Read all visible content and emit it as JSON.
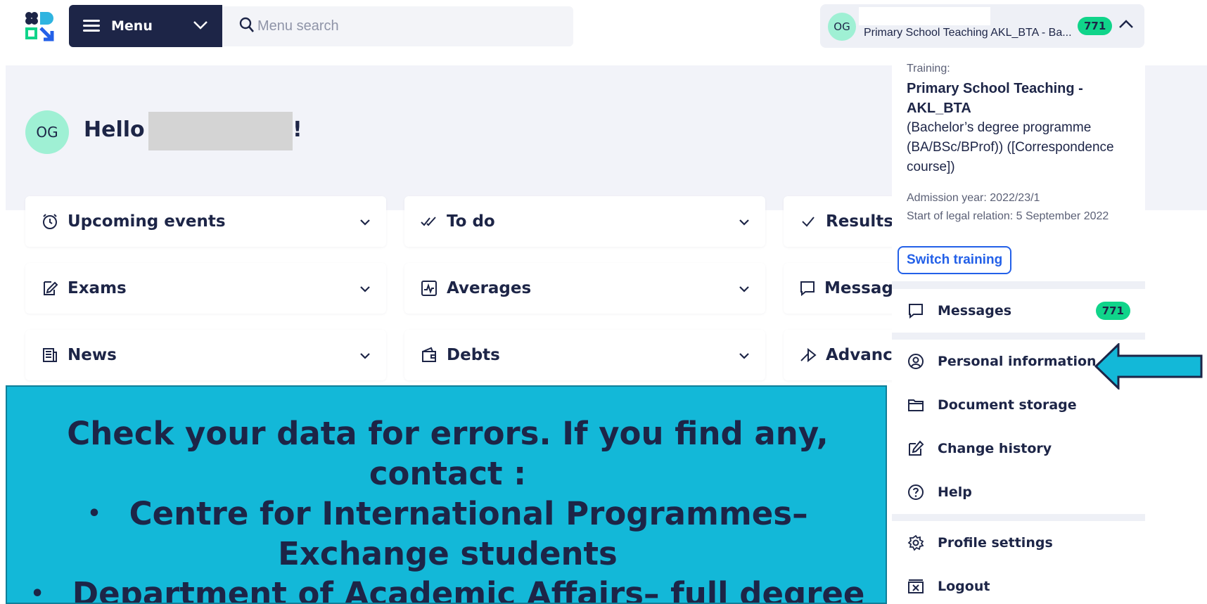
{
  "header": {
    "menu_label": "Menu",
    "search_placeholder": "Menu search",
    "user": {
      "initials": "OG",
      "training_short": "Primary School Teaching AKL_BTA - Ba...",
      "badge": "771"
    }
  },
  "hero": {
    "initials": "OG",
    "greeting": "Hello",
    "exclamation": "!"
  },
  "cards": [
    {
      "title": "Upcoming events",
      "icon": "alarm-clock-icon"
    },
    {
      "title": "To do",
      "icon": "double-check-icon"
    },
    {
      "title": "Results",
      "icon": "check-icon"
    },
    {
      "title": "Exams",
      "icon": "pencil-note-icon"
    },
    {
      "title": "Averages",
      "icon": "chart-icon"
    },
    {
      "title": "Messages",
      "icon": "message-icon"
    },
    {
      "title": "News",
      "icon": "newspaper-icon"
    },
    {
      "title": "Debts",
      "icon": "wallet-icon"
    },
    {
      "title": "Advance",
      "icon": "forward-arrow-icon"
    }
  ],
  "dropdown": {
    "training_label": "Training:",
    "training_name": "Primary School Teaching - AKL_BTA",
    "training_desc": "(Bachelor’s degree programme (BA/BSc/BProf)) ([Correspondence course])",
    "admission_year": "Admission year: 2022/23/1",
    "legal_start": "Start of legal relation: 5 September 2022",
    "switch_label": "Switch training",
    "items": [
      {
        "label": "Messages",
        "icon": "message-icon",
        "badge": "771"
      },
      {
        "label": "Personal information",
        "icon": "user-circle-icon"
      },
      {
        "label": "Document storage",
        "icon": "folder-icon"
      },
      {
        "label": "Change history",
        "icon": "edit-icon"
      },
      {
        "label": "Help",
        "icon": "help-icon"
      },
      {
        "label": "Profile settings",
        "icon": "gear-icon"
      },
      {
        "label": "Logout",
        "icon": "logout-icon"
      }
    ]
  },
  "overlay": {
    "line1": "Check your data for errors. If you find any,",
    "line2": "contact :",
    "bullet1_a": "Centre for International Programmes–",
    "bullet1_b": "Exchange students",
    "bullet2": "Department of Academic Affairs– full degree"
  },
  "colors": {
    "navy": "#1d2547",
    "accent_green": "#10d48a",
    "avatar_mint": "#9ff0d4",
    "overlay_cyan": "#13b8d8",
    "link_blue": "#2360e8"
  }
}
